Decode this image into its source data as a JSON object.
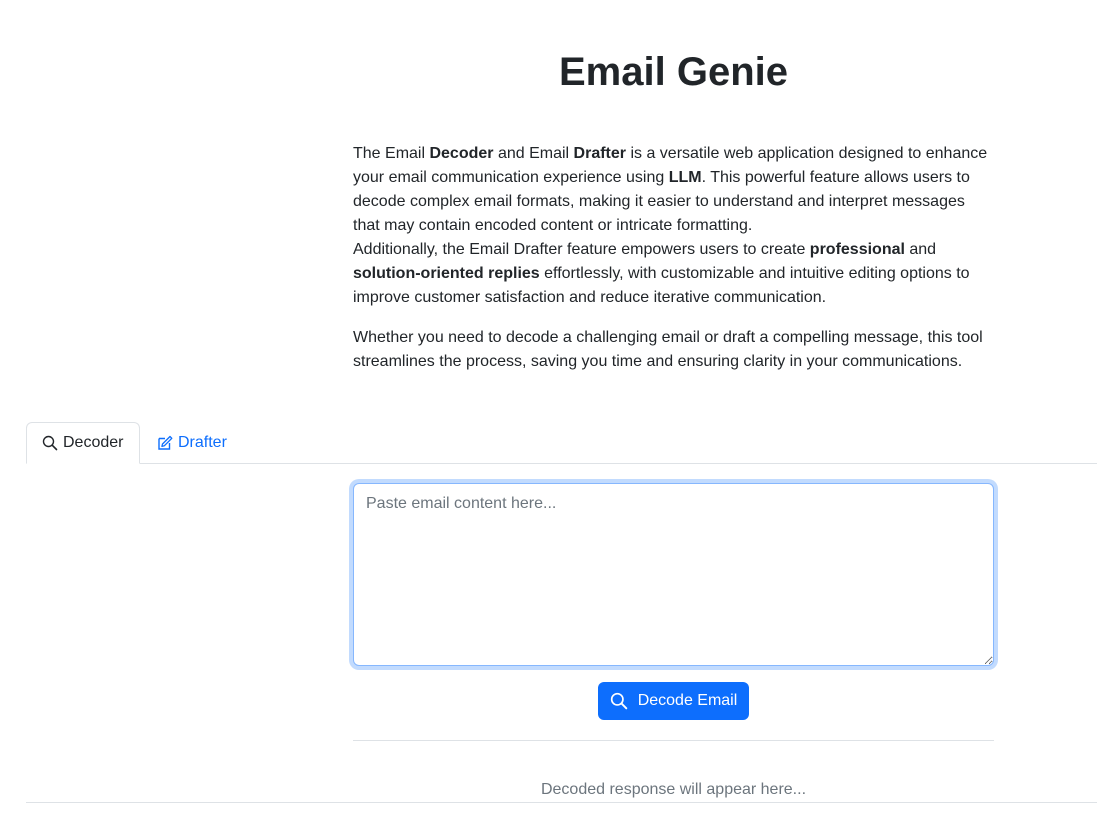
{
  "header": {
    "title": "Email Genie"
  },
  "intro": {
    "p1": {
      "t1": "The Email ",
      "b1": "Decoder",
      "t2": " and Email ",
      "b2": "Drafter",
      "t3": " is a versatile web application designed to enhance your email communication experience using ",
      "b3": "LLM",
      "t4": ". This powerful feature allows users to decode complex email formats, making it easier to understand and interpret messages that may contain encoded content or intricate formatting.",
      "t5": "Additionally, the Email Drafter feature empowers users to create ",
      "b4": "professional",
      "t6": " and ",
      "b5": "solution-oriented replies",
      "t7": " effortlessly, with customizable and intuitive editing options to improve customer satisfaction and reduce iterative communication."
    },
    "p2": "Whether you need to decode a challenging email or draft a compelling message, this tool streamlines the process, saving you time and ensuring clarity in your communications."
  },
  "tabs": [
    {
      "label": "Decoder",
      "icon": "search-icon",
      "active": true
    },
    {
      "label": "Drafter",
      "icon": "pencil-square-icon",
      "active": false
    }
  ],
  "decoder": {
    "input_placeholder": "Paste email content here...",
    "input_value": "",
    "button_label": "Decode Email",
    "button_icon": "search-icon",
    "response_placeholder": "Decoded response will appear here..."
  },
  "colors": {
    "primary": "#0d6efd",
    "text": "#212529",
    "muted": "#6c757d",
    "border": "#dee2e6"
  }
}
